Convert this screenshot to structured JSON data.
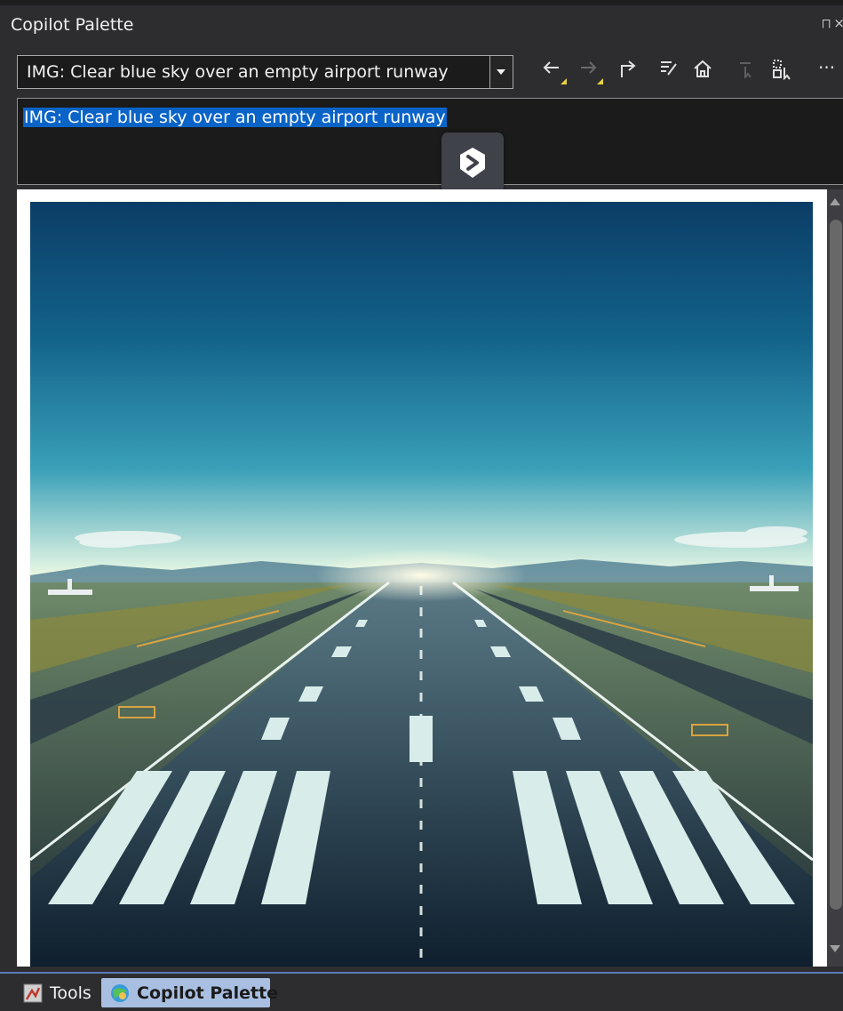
{
  "window": {
    "title": "Copilot Palette",
    "pin_glyph": "⨅",
    "close_glyph": "×"
  },
  "toolbar": {
    "combo_value": "IMG: Clear blue sky over an empty airport runway",
    "buttons": [
      {
        "icon": "back-arrow-icon",
        "enabled": true
      },
      {
        "icon": "forward-arrow-icon",
        "enabled": false
      },
      {
        "icon": "share-icon",
        "enabled": true
      },
      {
        "icon": "clear-icon",
        "enabled": true
      },
      {
        "icon": "home-icon",
        "enabled": true
      },
      {
        "icon": "select-cursor-icon",
        "enabled": false
      },
      {
        "icon": "select-objects-icon",
        "enabled": true
      },
      {
        "icon": "more-icon",
        "enabled": true
      }
    ],
    "more_glyph": "···"
  },
  "prompt": {
    "text": "IMG: Clear blue sky over an empty airport runway"
  },
  "image": {
    "subject": "runway-image"
  },
  "bottom_tabs": {
    "tools_label": "Tools",
    "copilot_label": "Copilot Palette",
    "active_highlight": "#a9bfe2"
  },
  "colors": {
    "window_bg": "#2d2d30",
    "selection": "#0a64c8",
    "accent": "#e6d43c"
  }
}
